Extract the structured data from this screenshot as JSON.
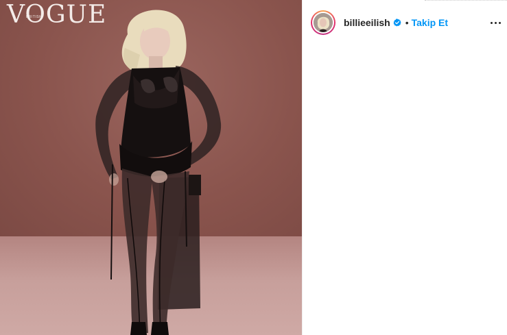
{
  "photo": {
    "masthead": "VOGUE",
    "masthead_subtitle": "BRITISH",
    "alt": "billieeilish post photo"
  },
  "header": {
    "username": "billieeilish",
    "separator": "•",
    "follow_label": "Takip Et",
    "verified": true
  },
  "colors": {
    "accent": "#0095f6",
    "text": "#262626",
    "background": "#ffffff"
  },
  "icons": {
    "verified": "verified-badge-icon",
    "more": "more-options-icon",
    "avatar_ring": "story-ring"
  }
}
